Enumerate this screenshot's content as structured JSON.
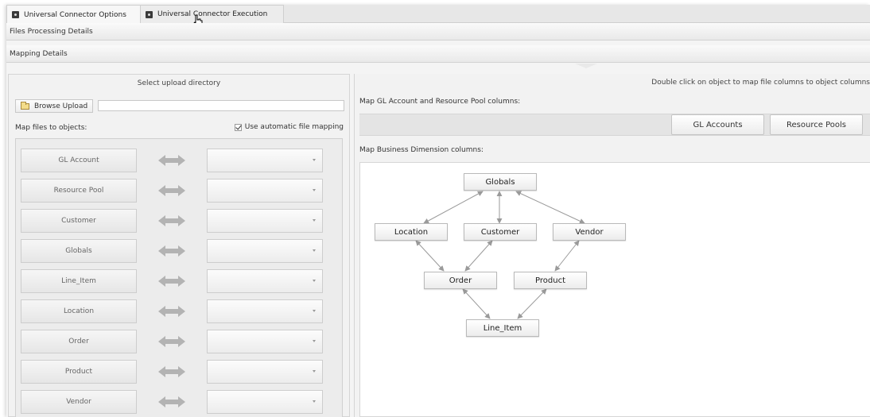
{
  "tabs": [
    {
      "label": "Universal Connector Options",
      "active": true
    },
    {
      "label": "Universal Connector Execution",
      "active": false
    }
  ],
  "sections": {
    "files_processing": "Files Processing Details",
    "mapping": "Mapping Details"
  },
  "left": {
    "title": "Select upload directory",
    "browse_label": "Browse Upload",
    "browse_value": "",
    "map_files_label": "Map files to objects:",
    "auto_mapping_label": "Use automatic file mapping",
    "auto_mapping_checked": true,
    "objects": [
      "GL Account",
      "Resource Pool",
      "Customer",
      "Globals",
      "Line_Item",
      "Location",
      "Order",
      "Product",
      "Vendor"
    ]
  },
  "right": {
    "hint": "Double click on object to map file columns to object columns",
    "map_gl_label": "Map GL Account and Resource Pool columns:",
    "gl_accounts_button": "GL Accounts",
    "resource_pools_button": "Resource Pools",
    "map_bd_label": "Map Business Dimension columns:",
    "nodes": {
      "globals": "Globals",
      "location": "Location",
      "customer": "Customer",
      "vendor": "Vendor",
      "order": "Order",
      "product": "Product",
      "line_item": "Line_Item"
    }
  },
  "colors": {
    "panel": "#f2f2f2",
    "canvas": "#ffffff",
    "connector": "#9a9a9a"
  }
}
